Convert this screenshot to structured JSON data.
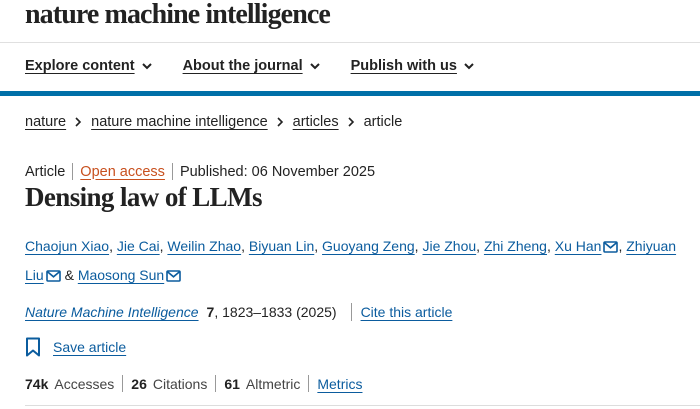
{
  "header": {
    "masthead": "nature machine intelligence"
  },
  "nav": {
    "items": [
      {
        "label": "Explore content"
      },
      {
        "label": "About the journal"
      },
      {
        "label": "Publish with us"
      }
    ]
  },
  "breadcrumb": {
    "items": [
      "nature",
      "nature machine intelligence",
      "articles",
      "article"
    ]
  },
  "article": {
    "type": "Article",
    "access": "Open access",
    "published": "Published: 06 November 2025",
    "title": "Densing law of LLMs",
    "authors": [
      {
        "name": "Chaojun Xiao",
        "sep": ", "
      },
      {
        "name": "Jie Cai",
        "sep": ", "
      },
      {
        "name": "Weilin Zhao",
        "sep": ", "
      },
      {
        "name": "Biyuan Lin",
        "sep": ", "
      },
      {
        "name": "Guoyang Zeng",
        "sep": ", "
      },
      {
        "name": "Jie Zhou",
        "sep": ", "
      },
      {
        "name": "Zhi Zheng",
        "sep": ", "
      },
      {
        "name": "Xu Han",
        "sep": ", "
      },
      {
        "name": "Zhiyuan Liu",
        "sep": " & "
      },
      {
        "name": "Maosong Sun",
        "sep": ""
      }
    ],
    "citation": {
      "journal": "Nature Machine Intelligence",
      "volume": "7",
      "pages_year": ", 1823–1833 (2025)",
      "cite_label": "Cite this article"
    },
    "save_label": "Save article",
    "metrics": {
      "accesses_value": "74k",
      "accesses_label": "Accesses",
      "citations_value": "26",
      "citations_label": "Citations",
      "altmetric_value": "61",
      "altmetric_label": "Altmetric",
      "metrics_link": "Metrics"
    }
  },
  "colors": {
    "accent_bar": "#0070a8",
    "link": "#0b5c9e",
    "open_access": "#c8501e"
  }
}
